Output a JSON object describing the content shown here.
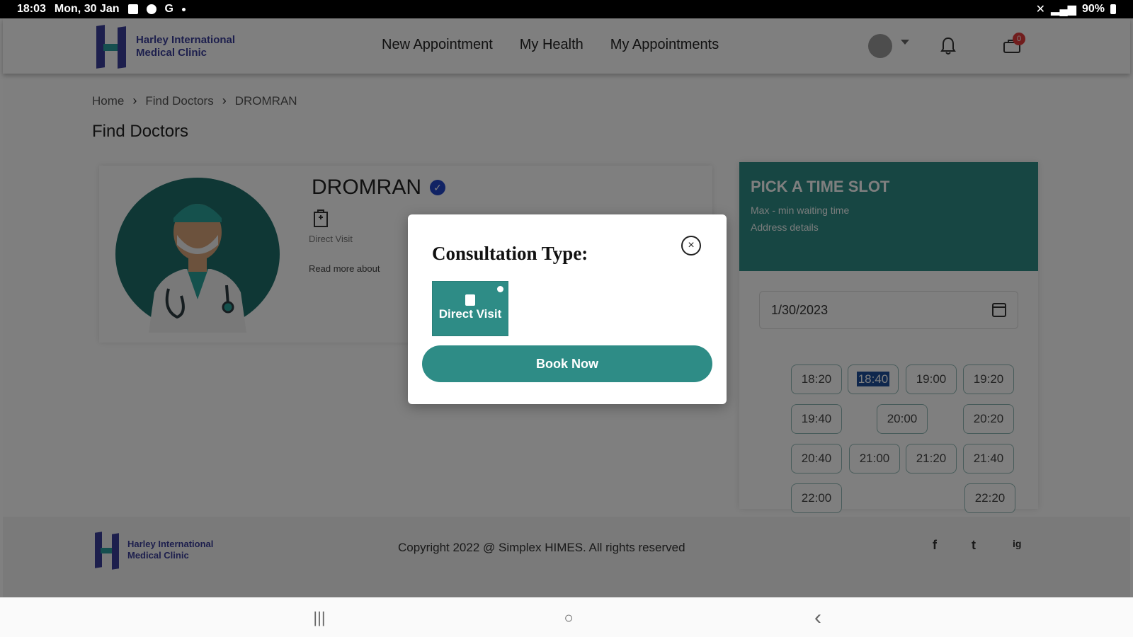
{
  "status_bar": {
    "time": "18:03",
    "date": "Mon, 30 Jan",
    "battery": "90%"
  },
  "header": {
    "logo_line1": "Harley International",
    "logo_line2": "Medical Clinic",
    "nav": [
      "New Appointment",
      "My Health",
      "My Appointments"
    ],
    "cart_count": "0"
  },
  "breadcrumb": [
    "Home",
    "Find Doctors",
    "DROMRAN"
  ],
  "page_title": "Find Doctors",
  "doctor": {
    "name": "DROMRAN",
    "visit_type": "Direct Visit",
    "read_more": "Read more about"
  },
  "slot_panel": {
    "title": "PICK A TIME SLOT",
    "sub1": "Max - min waiting time",
    "sub2": "Address details",
    "date": "1/30/2023",
    "times": [
      "18:20",
      "18:40",
      "19:00",
      "19:20",
      "19:40",
      "20:00",
      "20:20",
      "20:40",
      "21:00",
      "21:20",
      "21:40",
      "22:00",
      "22:20"
    ],
    "selected_time": "18:40"
  },
  "footer": {
    "logo_line1": "Harley International",
    "logo_line2": "Medical Clinic",
    "copyright": "Copyright 2022 @ Simplex HIMES. All rights reserved",
    "social": [
      "f",
      "t",
      "ig"
    ]
  },
  "modal": {
    "title": "Consultation Type:",
    "close": "×",
    "option_label": "Direct Visit",
    "book_label": "Book Now"
  },
  "colors": {
    "brand_teal": "#2e8c86",
    "brand_indigo": "#3b3f9a"
  },
  "system_nav": {
    "recent": "|||",
    "home": "○",
    "back": "‹"
  }
}
